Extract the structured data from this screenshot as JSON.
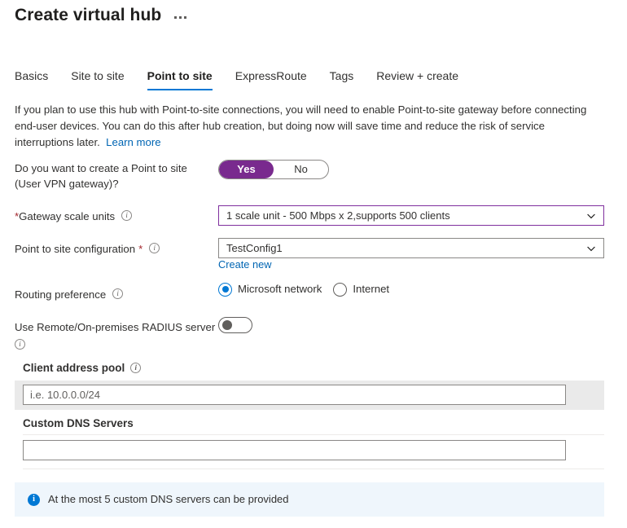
{
  "header": {
    "title": "Create virtual hub",
    "more_menu": "…"
  },
  "tabs": [
    {
      "label": "Basics",
      "active": false
    },
    {
      "label": "Site to site",
      "active": false
    },
    {
      "label": "Point to site",
      "active": true
    },
    {
      "label": "ExpressRoute",
      "active": false
    },
    {
      "label": "Tags",
      "active": false
    },
    {
      "label": "Review + create",
      "active": false
    }
  ],
  "intro": {
    "text": "If you plan to use this hub with Point-to-site connections, you will need to enable Point-to-site gateway before connecting end-user devices. You can do this after hub creation, but doing now will save time and reduce the risk of service interruptions later.",
    "link": "Learn more"
  },
  "form": {
    "create_p2s": {
      "label_line1": "Do you want to create a Point to site",
      "label_line2": "(User VPN gateway)?",
      "options": [
        "Yes",
        "No"
      ],
      "selected": "Yes",
      "selected_color": "#792a8e"
    },
    "gateway_scale_units": {
      "label": "Gateway scale units",
      "required_mark": "*",
      "info_icon": "info-icon",
      "value": "1 scale unit - 500 Mbps x 2,supports 500 clients",
      "chevron": "chevron-down-icon",
      "border_color": "#7f2f9e"
    },
    "p2s_configuration": {
      "label": "Point to site configuration",
      "required_mark": "*",
      "info_icon": "info-icon",
      "value": "TestConfig1",
      "chevron": "chevron-down-icon",
      "create_new_link": "Create new"
    },
    "routing_preference": {
      "label": "Routing preference",
      "info_icon": "info-icon",
      "options": [
        {
          "label": "Microsoft network",
          "selected": true
        },
        {
          "label": "Internet",
          "selected": false
        }
      ],
      "accent_color": "#0078d4"
    },
    "radius_server": {
      "label": "Use Remote/On-premises RADIUS server",
      "info_icon": "info-icon",
      "state": "off"
    },
    "client_address_pool": {
      "label": "Client address pool",
      "info_icon": "info-icon",
      "placeholder": "i.e. 10.0.0.0/24",
      "value": ""
    },
    "custom_dns_servers": {
      "label": "Custom DNS Servers",
      "placeholder": "",
      "value": ""
    }
  },
  "banner": {
    "icon": "info-filled-icon",
    "text": "At the most 5 custom DNS servers can be provided",
    "background": "#eff6fc",
    "icon_color": "#0078d4"
  }
}
